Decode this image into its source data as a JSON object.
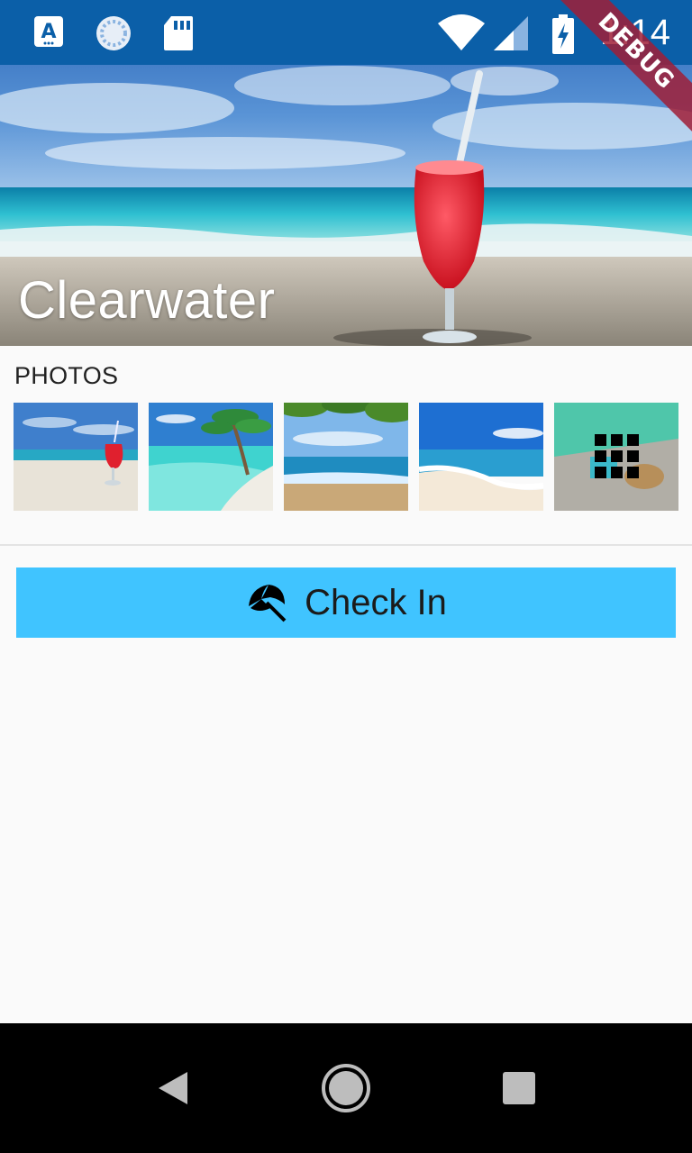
{
  "status_bar": {
    "time": "1:14",
    "icons": [
      "accessibility-text-icon",
      "sync-icon",
      "sd-card-icon",
      "wifi-icon",
      "signal-icon",
      "battery-charging-icon"
    ]
  },
  "debug_banner": "DEBUG",
  "hero": {
    "title": "Clearwater"
  },
  "photos": {
    "heading": "PHOTOS",
    "thumbnails": [
      "drink-on-beach",
      "palm-tree-lagoon",
      "beach-under-leaves",
      "wave-on-shore",
      "pool-view-all"
    ]
  },
  "check_in": {
    "label": "Check In",
    "icon": "beach-umbrella-icon"
  },
  "nav": {
    "buttons": [
      "back",
      "home",
      "recents"
    ]
  },
  "colors": {
    "accent": "#40c4ff",
    "status_bar": "#0b5fa8",
    "debug": "#a01e37"
  }
}
